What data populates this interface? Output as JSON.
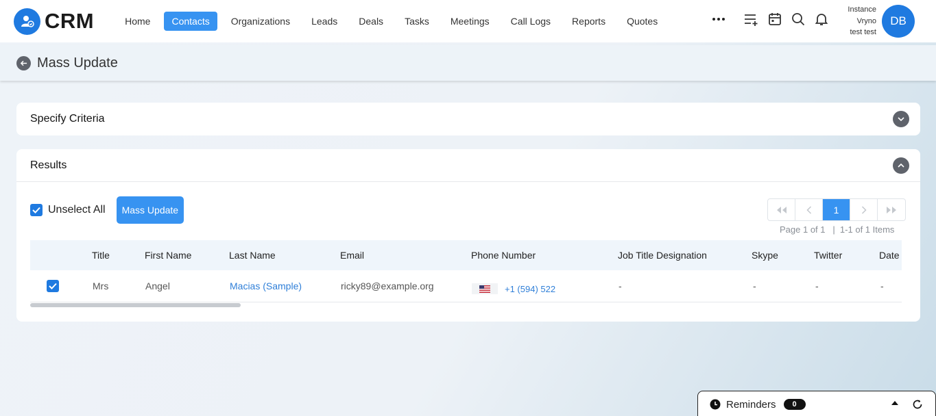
{
  "app": {
    "logo_text": "CRM",
    "logo_icon": "user-group-icon"
  },
  "nav": {
    "items": [
      {
        "label": "Home",
        "active": false
      },
      {
        "label": "Contacts",
        "active": true
      },
      {
        "label": "Organizations",
        "active": false
      },
      {
        "label": "Leads",
        "active": false
      },
      {
        "label": "Deals",
        "active": false
      },
      {
        "label": "Tasks",
        "active": false
      },
      {
        "label": "Meetings",
        "active": false
      },
      {
        "label": "Call Logs",
        "active": false
      },
      {
        "label": "Reports",
        "active": false
      },
      {
        "label": "Quotes",
        "active": false
      }
    ],
    "icons": [
      "more-icon",
      "add-list-icon",
      "calendar-icon",
      "search-icon",
      "bell-icon"
    ]
  },
  "user": {
    "line1": "Instance",
    "line2": "Vryno",
    "line3": "test test",
    "initials": "DB"
  },
  "page": {
    "title": "Mass Update"
  },
  "criteria": {
    "title": "Specify Criteria"
  },
  "results": {
    "title": "Results",
    "unselect_label": "Unselect All",
    "mass_update_label": "Mass Update",
    "pager": {
      "current_page": "1",
      "info": "Page 1 of 1   |  1-1 of 1 Items"
    },
    "columns": [
      "Title",
      "First Name",
      "Last Name",
      "Email",
      "Phone Number",
      "Job Title Designation",
      "Skype",
      "Twitter",
      "Date"
    ],
    "rows": [
      {
        "title": "Mrs",
        "first_name": "Angel",
        "last_name": "Macias (Sample)",
        "email": "ricky89@example.org",
        "phone": "+1 (594) 522",
        "job_title": "-",
        "skype": "-",
        "twitter": "-",
        "date": "-"
      }
    ]
  },
  "reminders": {
    "label": "Reminders",
    "count": "0"
  },
  "colors": {
    "primary": "#1f7ae0",
    "accent": "#3793f1",
    "link": "#2f7fd8"
  }
}
